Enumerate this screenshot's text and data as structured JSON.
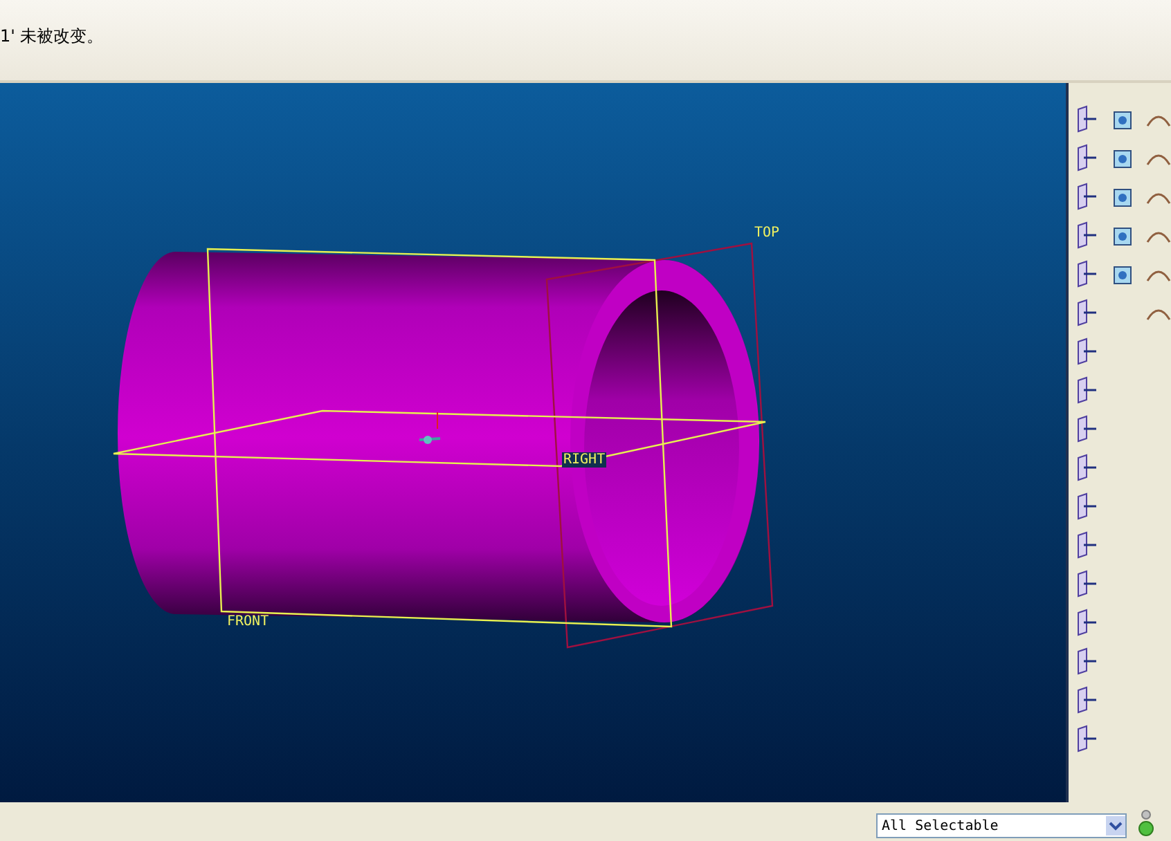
{
  "message_area": {
    "message": "1' 未被改变。"
  },
  "viewport": {
    "datum_labels": [
      {
        "kind": "top",
        "text": "TOP"
      },
      {
        "kind": "right",
        "text": "RIGHT"
      },
      {
        "kind": "front",
        "text": "FRONT"
      }
    ]
  },
  "status_bar": {
    "filter": {
      "value": "All Selectable"
    }
  }
}
